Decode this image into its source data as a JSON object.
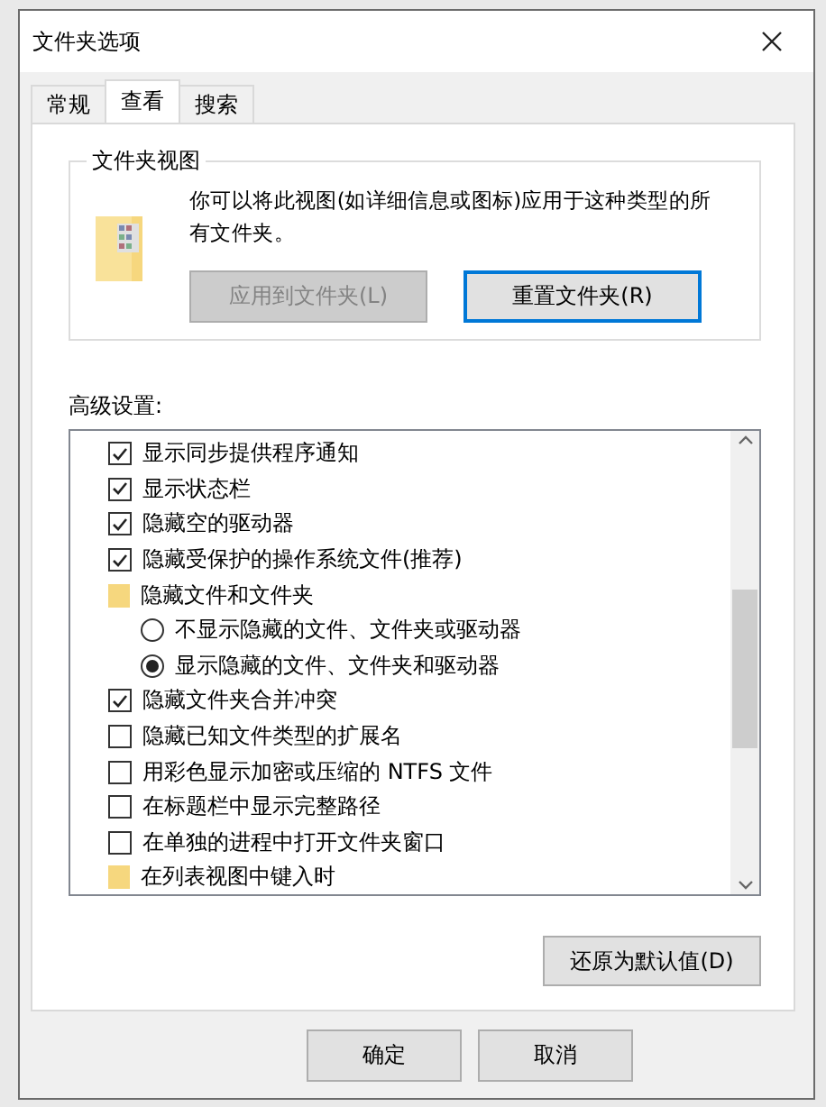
{
  "window": {
    "title": "文件夹选项"
  },
  "tabs": [
    {
      "label": "常规",
      "selected": false
    },
    {
      "label": "查看",
      "selected": true
    },
    {
      "label": "搜索",
      "selected": false
    }
  ],
  "folder_views": {
    "title": "文件夹视图",
    "description": "你可以将此视图(如详细信息或图标)应用于这种类型的所有文件夹。",
    "buttons": [
      {
        "label": "应用到文件夹(L)",
        "disabled": true
      },
      {
        "label": "重置文件夹(R)",
        "disabled": false
      }
    ]
  },
  "advanced": {
    "label": "高级设置:",
    "items": [
      {
        "kind": "checkbox",
        "label": "显示同步提供程序通知",
        "checked": true
      },
      {
        "kind": "checkbox",
        "label": "显示状态栏",
        "checked": true
      },
      {
        "kind": "checkbox",
        "label": "隐藏空的驱动器",
        "checked": true
      },
      {
        "kind": "checkbox",
        "label": "隐藏受保护的操作系统文件(推荐)",
        "checked": true
      },
      {
        "kind": "folder",
        "label": "隐藏文件和文件夹"
      },
      {
        "kind": "radio",
        "label": "不显示隐藏的文件、文件夹或驱动器",
        "selected": false
      },
      {
        "kind": "radio",
        "label": "显示隐藏的文件、文件夹和驱动器",
        "selected": true
      },
      {
        "kind": "checkbox",
        "label": "隐藏文件夹合并冲突",
        "checked": true
      },
      {
        "kind": "checkbox",
        "label": "隐藏已知文件类型的扩展名",
        "checked": false
      },
      {
        "kind": "checkbox",
        "label": "用彩色显示加密或压缩的 NTFS 文件",
        "checked": false
      },
      {
        "kind": "checkbox",
        "label": "在标题栏中显示完整路径",
        "checked": false
      },
      {
        "kind": "checkbox",
        "label": "在单独的进程中打开文件夹窗口",
        "checked": false
      },
      {
        "kind": "folder",
        "label": "在列表视图中键入时"
      }
    ]
  },
  "restore_button": "还原为默认值(D)",
  "buttons": [
    "确定",
    "取消"
  ]
}
